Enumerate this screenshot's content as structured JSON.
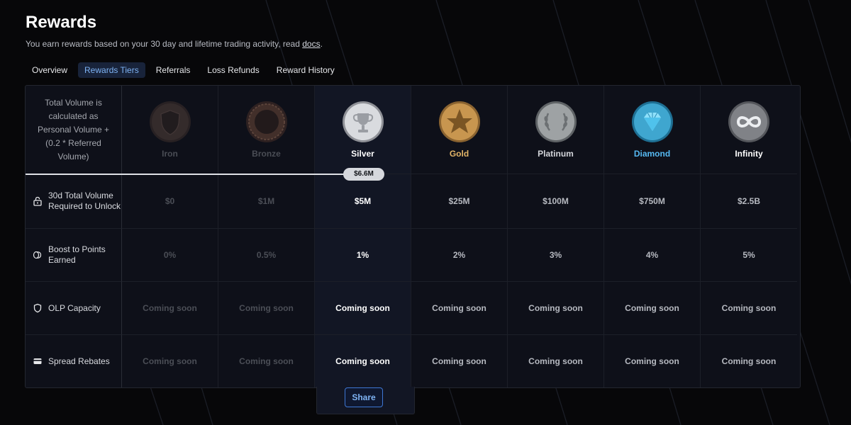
{
  "page": {
    "title": "Rewards",
    "subtitle_text": "You earn rewards based on your 30 day and lifetime trading activity, read ",
    "docs_link": "docs",
    "subtitle_end": "."
  },
  "tabs": [
    {
      "label": "Overview",
      "active": false
    },
    {
      "label": "Rewards Tiers",
      "active": true
    },
    {
      "label": "Referrals",
      "active": false
    },
    {
      "label": "Loss Refunds",
      "active": false
    },
    {
      "label": "Reward History",
      "active": false
    }
  ],
  "table": {
    "volume_note": "Total Volume is calculated as Personal Volume + (0.2 * Referred Volume)",
    "progress_value": "$6.6M",
    "tiers": [
      {
        "name": "Iron",
        "color": "#4a4d55",
        "icon": "iron-shield-medal-icon"
      },
      {
        "name": "Bronze",
        "color": "#4a4d55",
        "icon": "bronze-medal-icon"
      },
      {
        "name": "Silver",
        "color": "#ffffff",
        "icon": "silver-trophy-medal-icon"
      },
      {
        "name": "Gold",
        "color": "#e3b568",
        "icon": "gold-star-medal-icon"
      },
      {
        "name": "Platinum",
        "color": "#d3d5da",
        "icon": "platinum-laurel-medal-icon"
      },
      {
        "name": "Diamond",
        "color": "#56b9f2",
        "icon": "diamond-medal-icon"
      },
      {
        "name": "Infinity",
        "color": "#ffffff",
        "icon": "infinity-medal-icon"
      }
    ],
    "rows": [
      {
        "label": "30d Total Volume Required to Unlock",
        "icon": "lock-icon",
        "values": [
          "$0",
          "$1M",
          "$5M",
          "$25M",
          "$100M",
          "$750M",
          "$2.5B"
        ]
      },
      {
        "label": "Boost to Points Earned",
        "icon": "coins-icon",
        "values": [
          "0%",
          "0.5%",
          "1%",
          "2%",
          "3%",
          "4%",
          "5%"
        ]
      },
      {
        "label": "OLP Capacity",
        "icon": "shield-icon",
        "values": [
          "Coming soon",
          "Coming soon",
          "Coming soon",
          "Coming soon",
          "Coming soon",
          "Coming soon",
          "Coming soon"
        ]
      },
      {
        "label": "Spread Rebates",
        "icon": "card-icon",
        "values": [
          "Coming soon",
          "Coming soon",
          "Coming soon",
          "Coming soon",
          "Coming soon",
          "Coming soon",
          "Coming soon"
        ]
      }
    ]
  },
  "share_button": "Share"
}
